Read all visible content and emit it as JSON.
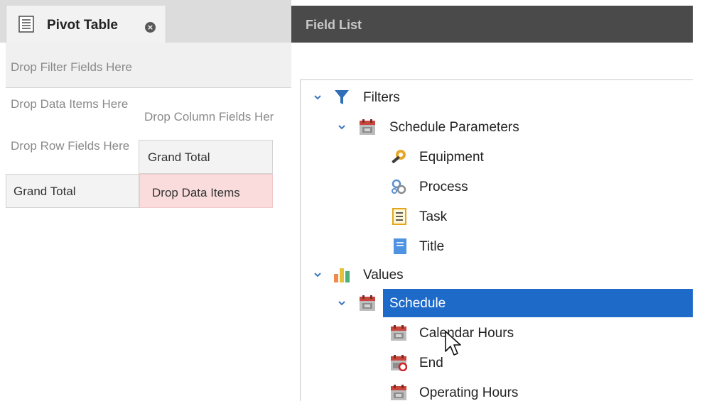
{
  "tab": {
    "title": "Pivot Table",
    "close_glyph": "×",
    "icon": "list-document-icon"
  },
  "pivot": {
    "filter_zone": "Drop Filter Fields Here",
    "data_items_zone": "Drop Data Items Here",
    "column_fields_zone": "Drop Column Fields Her",
    "row_fields_zone": "Drop Row Fields Here",
    "grand_total_column": "Grand Total",
    "grand_total_row": "Grand Total",
    "data_cell": "Drop Data Items"
  },
  "field_list": {
    "title": "Field List",
    "tree": {
      "filters": {
        "label": "Filters",
        "icon": "funnel-icon",
        "group": {
          "label": "Schedule Parameters",
          "icon": "calendar-icon",
          "items": [
            {
              "label": "Equipment",
              "icon": "wrench-gear-icon"
            },
            {
              "label": "Process",
              "icon": "gears-icon"
            },
            {
              "label": "Task",
              "icon": "checklist-icon"
            },
            {
              "label": "Title",
              "icon": "text-lines-icon"
            }
          ]
        }
      },
      "values": {
        "label": "Values",
        "icon": "bar-chart-icon",
        "group": {
          "label": "Schedule",
          "icon": "calendar-icon",
          "selected": true,
          "items": [
            {
              "label": "Calendar Hours",
              "icon": "calendar-icon"
            },
            {
              "label": "End",
              "icon": "calendar-end-icon"
            },
            {
              "label": "Operating Hours",
              "icon": "calendar-icon"
            }
          ]
        }
      }
    }
  },
  "colors": {
    "selection": "#1e6ac9",
    "field_list_header": "#4a4a4a",
    "data_cell_background": "#fbdcdc",
    "funnel": "#2f6fb8",
    "calendar_red": "#c8463c"
  }
}
